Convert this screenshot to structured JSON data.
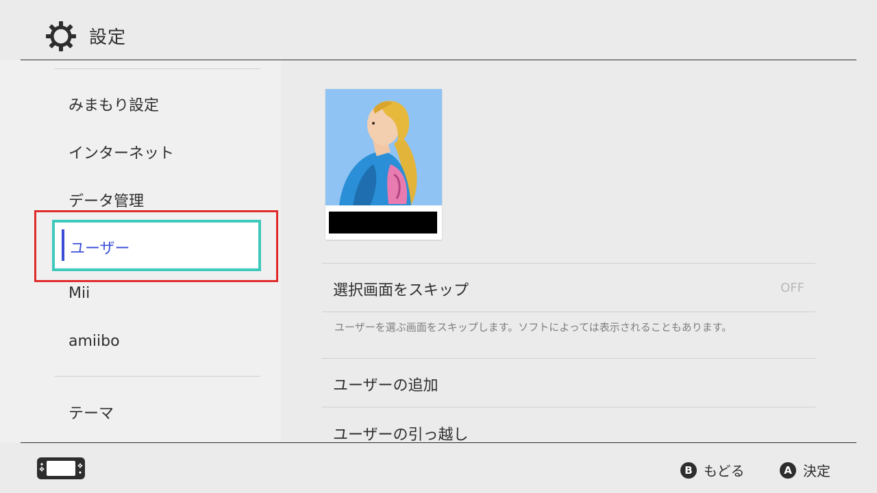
{
  "header": {
    "title": "設定",
    "icon": "gear-icon"
  },
  "sidebar": {
    "items": [
      {
        "label": "みまもり設定"
      },
      {
        "label": "インターネット"
      },
      {
        "label": "データ管理"
      },
      {
        "label": "ユーザー",
        "selected": true
      },
      {
        "label": "Mii"
      },
      {
        "label": "amiibo"
      },
      {
        "label": "テーマ"
      }
    ]
  },
  "content": {
    "user_card": {
      "avatar_icon": "user-avatar",
      "name_redacted": true
    },
    "skip_select": {
      "label": "選択画面をスキップ",
      "value": "OFF"
    },
    "skip_description": "ユーザーを選ぶ画面をスキップします。ソフトによっては表示されることもあります。",
    "add_user": "ユーザーの追加",
    "transfer_user": "ユーザーの引っ越し"
  },
  "footer": {
    "console_icon": "switch-console-icon",
    "back": {
      "button": "B",
      "label": "もどる"
    },
    "ok": {
      "button": "A",
      "label": "決定"
    }
  },
  "colors": {
    "background": "#ebebeb",
    "sidebar_bg": "#f0f0f0",
    "selected_text": "#3a4fd6",
    "selection_border": "#3ec9bb",
    "annotation_frame": "#e02a2a"
  }
}
